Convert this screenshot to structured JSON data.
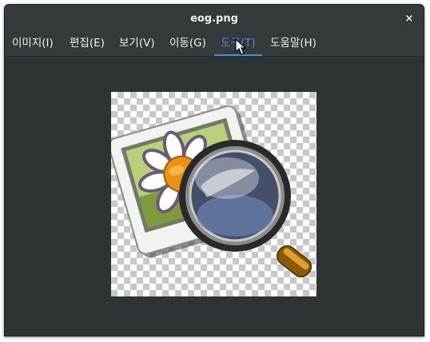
{
  "window": {
    "title": "eog.png",
    "close_label": "×"
  },
  "menubar": {
    "items": [
      {
        "label": "이미지(I)"
      },
      {
        "label": "편집(E)"
      },
      {
        "label": "보기(V)"
      },
      {
        "label": "이동(G)"
      },
      {
        "label": "도구(T)"
      },
      {
        "label": "도움말(H)"
      }
    ],
    "active_index": 4
  },
  "icons": {
    "close": "close-icon",
    "cursor": "mouse-pointer-icon",
    "image": "eog-app-icon"
  },
  "colors": {
    "window_bg": "#2e3436",
    "titlebar_bg": "#353b3d",
    "accent": "#4a90d9",
    "text": "#eeeeec"
  }
}
